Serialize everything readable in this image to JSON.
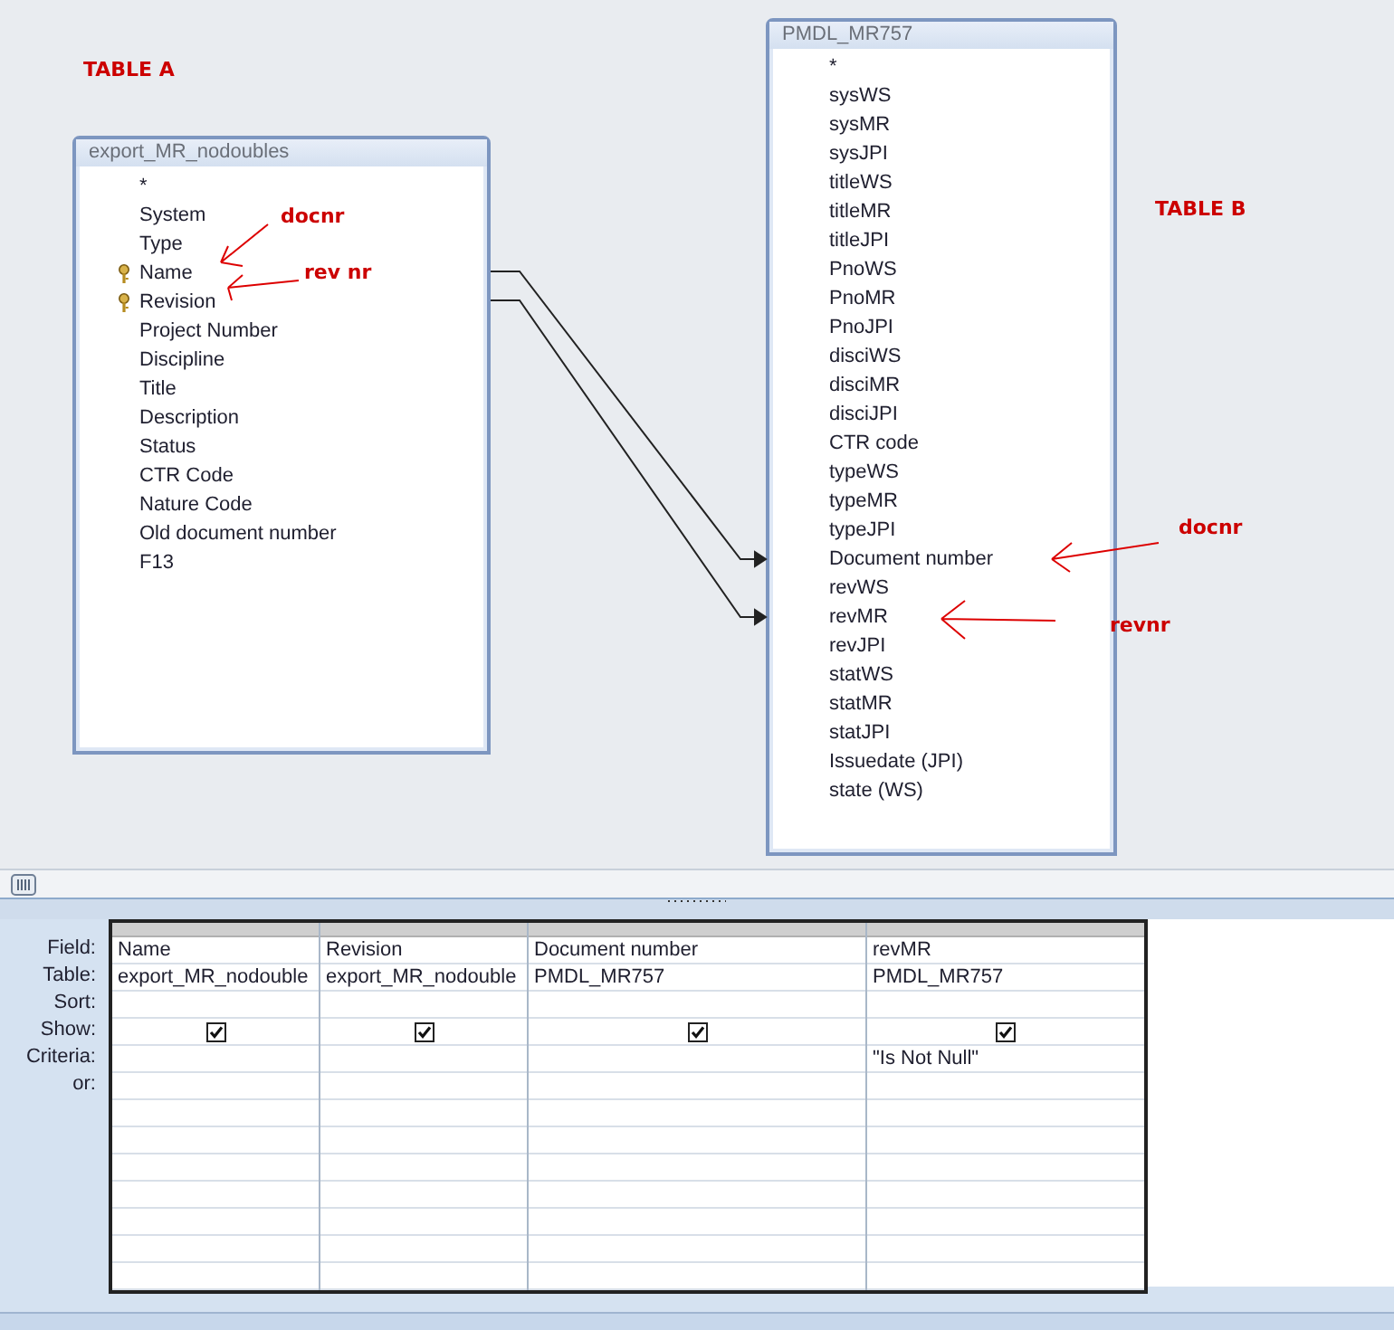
{
  "diagram": {
    "tables": [
      {
        "title": "export_MR_nodoubles",
        "fields": [
          {
            "name": "*",
            "key": false
          },
          {
            "name": "System",
            "key": false
          },
          {
            "name": "Type",
            "key": false
          },
          {
            "name": "Name",
            "key": true
          },
          {
            "name": "Revision",
            "key": true
          },
          {
            "name": "Project Number",
            "key": false
          },
          {
            "name": "Discipline",
            "key": false
          },
          {
            "name": "Title",
            "key": false
          },
          {
            "name": "Description",
            "key": false
          },
          {
            "name": "Status",
            "key": false
          },
          {
            "name": "CTR Code",
            "key": false
          },
          {
            "name": "Nature Code",
            "key": false
          },
          {
            "name": "Old document number",
            "key": false
          },
          {
            "name": "F13",
            "key": false
          }
        ]
      },
      {
        "title": "PMDL_MR757",
        "fields": [
          {
            "name": "*",
            "key": false
          },
          {
            "name": "sysWS",
            "key": false
          },
          {
            "name": "sysMR",
            "key": false
          },
          {
            "name": "sysJPI",
            "key": false
          },
          {
            "name": "titleWS",
            "key": false
          },
          {
            "name": "titleMR",
            "key": false
          },
          {
            "name": "titleJPI",
            "key": false
          },
          {
            "name": "PnoWS",
            "key": false
          },
          {
            "name": "PnoMR",
            "key": false
          },
          {
            "name": "PnoJPI",
            "key": false
          },
          {
            "name": "disciWS",
            "key": false
          },
          {
            "name": "disciMR",
            "key": false
          },
          {
            "name": "disciJPI",
            "key": false
          },
          {
            "name": "CTR code",
            "key": false
          },
          {
            "name": "typeWS",
            "key": false
          },
          {
            "name": "typeMR",
            "key": false
          },
          {
            "name": "typeJPI",
            "key": false
          },
          {
            "name": "Document number",
            "key": false
          },
          {
            "name": "revWS",
            "key": false
          },
          {
            "name": "revMR",
            "key": false
          },
          {
            "name": "revJPI",
            "key": false
          },
          {
            "name": "statWS",
            "key": false
          },
          {
            "name": "statMR",
            "key": false
          },
          {
            "name": "statJPI",
            "key": false
          },
          {
            "name": "Issuedate (JPI)",
            "key": false
          },
          {
            "name": "state (WS)",
            "key": false
          }
        ]
      }
    ],
    "annotations": [
      "TABLE A",
      "docnr",
      "rev nr",
      "TABLE B",
      "docnr",
      "revnr"
    ]
  },
  "query_grid": {
    "row_labels": [
      "Field:",
      "Table:",
      "Sort:",
      "Show:",
      "Criteria:",
      "or:"
    ],
    "columns": [
      {
        "field": "Name",
        "table": "export_MR_nodouble",
        "show": true
      },
      {
        "field": "Revision",
        "table": "export_MR_nodouble",
        "show": true
      },
      {
        "field": "Document number",
        "table": "PMDL_MR757",
        "show": true
      },
      {
        "field": "revMR",
        "table": "PMDL_MR757",
        "show": true,
        "criteria": "\"Is Not Null\""
      }
    ]
  }
}
